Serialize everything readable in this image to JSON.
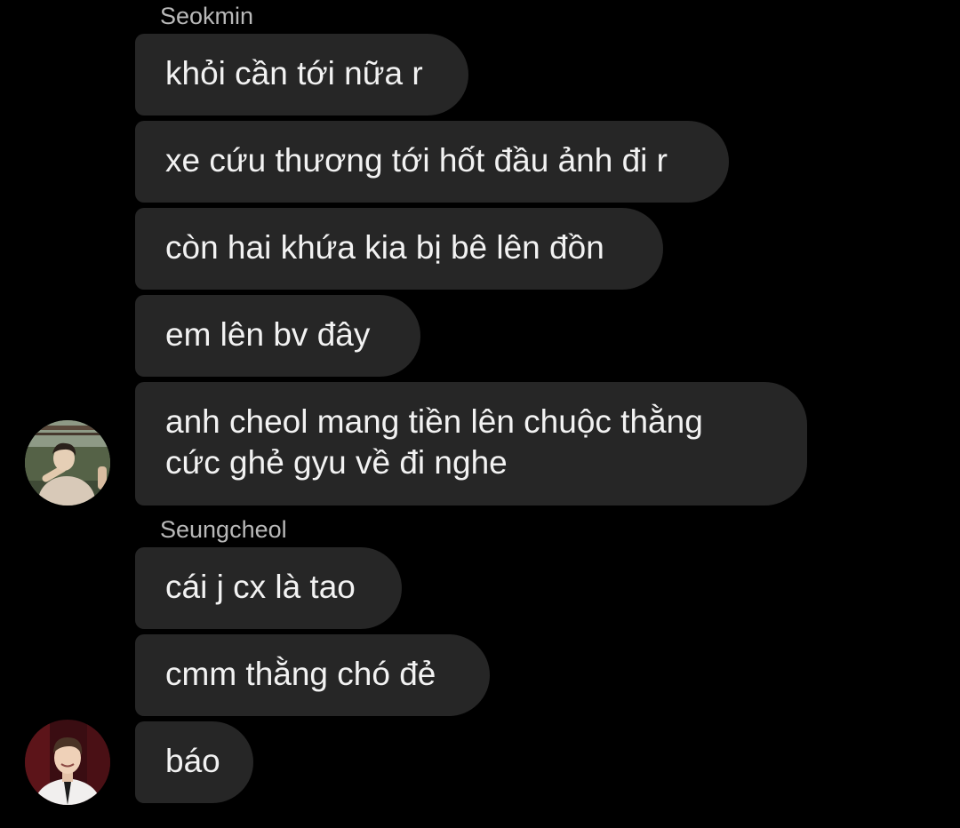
{
  "thread": {
    "groups": [
      {
        "sender": "Seokmin",
        "avatar_icon": "user-avatar-icon",
        "messages": [
          "khỏi cần tới nữa r",
          "xe cứu thương tới hốt đầu ảnh đi r",
          "còn hai khứa kia bị bê lên đồn",
          "em lên bv đây",
          [
            "anh cheol mang tiền lên chuộc thằng",
            "cức ghẻ gyu về đi nghe"
          ]
        ]
      },
      {
        "sender": "Seungcheol",
        "avatar_icon": "user-avatar-icon",
        "messages": [
          "cái j cx là tao",
          "cmm thằng chó đẻ",
          "báo"
        ]
      }
    ]
  },
  "colors": {
    "background": "#000000",
    "bubble": "#262626",
    "message_text": "#f2f2f2",
    "sender_text": "#b9b9b9"
  }
}
